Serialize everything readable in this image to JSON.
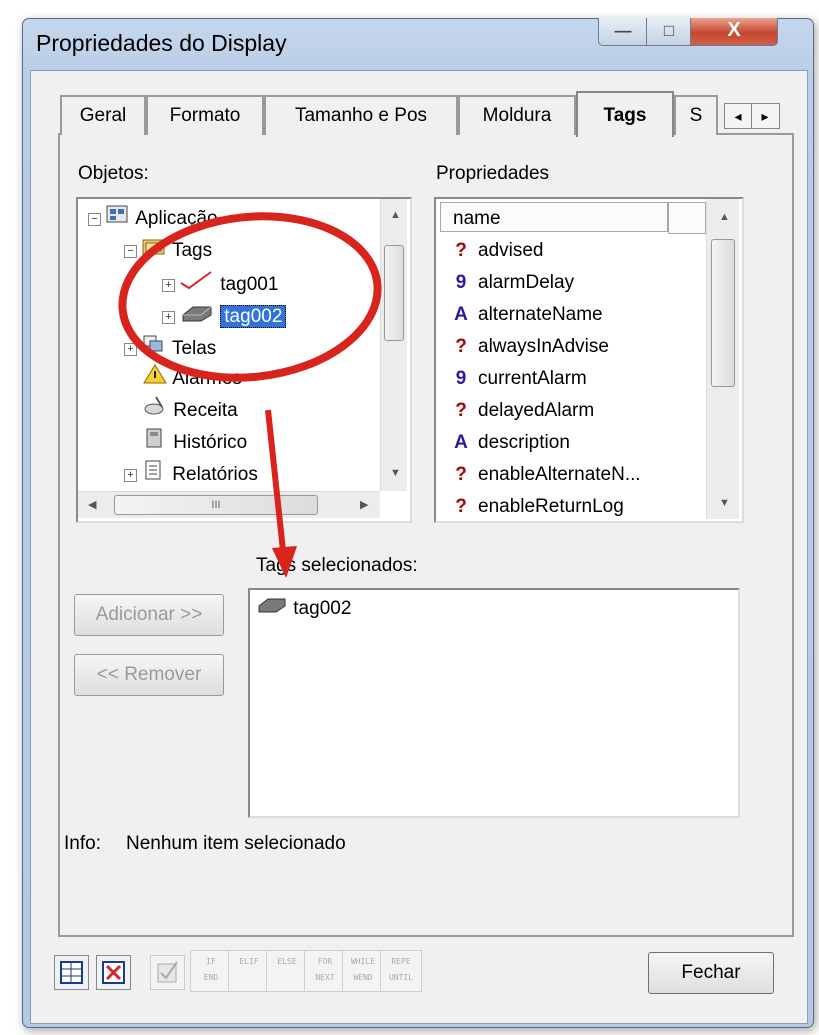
{
  "window": {
    "title": "Propriedades do Display",
    "minimize_glyph": "—",
    "maximize_glyph": "□",
    "close_glyph": "X"
  },
  "tabs": [
    {
      "label": "Geral"
    },
    {
      "label": "Formato"
    },
    {
      "label": "Tamanho e Pos"
    },
    {
      "label": "Moldura"
    },
    {
      "label": "Tags"
    },
    {
      "label": "S"
    }
  ],
  "tab_scroll": {
    "left": "◂",
    "right": "▸"
  },
  "objetos": {
    "label": "Objetos:",
    "tree": [
      {
        "label": "Aplicação",
        "expander": "−",
        "icon": "application-icon"
      },
      {
        "label": "Tags",
        "expander": "−",
        "icon": "folder-icon"
      },
      {
        "label": "tag001",
        "expander": "+",
        "icon": "trend-icon"
      },
      {
        "label": "tag002",
        "expander": "+",
        "icon": "tag-icon",
        "selected": true
      },
      {
        "label": "Telas",
        "expander": "+",
        "icon": "screens-icon"
      },
      {
        "label": "Alarmes",
        "icon": "alarm-icon"
      },
      {
        "label": "Receita",
        "icon": "recipe-icon"
      },
      {
        "label": "Histórico",
        "icon": "history-icon"
      },
      {
        "label": "Relatórios",
        "expander": "+",
        "icon": "report-icon"
      }
    ],
    "hscroll_grip": "III"
  },
  "propriedades": {
    "label": "Propriedades",
    "column_header": "name",
    "items": [
      {
        "name": "advised",
        "type_glyph": "?",
        "icon": "boolean-icon",
        "color": "#b00000"
      },
      {
        "name": "alarmDelay",
        "type_glyph": "9",
        "icon": "number-icon",
        "color": "#2a1aa0"
      },
      {
        "name": "alternateName",
        "type_glyph": "A",
        "icon": "string-icon",
        "color": "#2a1aa0"
      },
      {
        "name": "alwaysInAdvise",
        "type_glyph": "?",
        "icon": "boolean-icon",
        "color": "#b00000"
      },
      {
        "name": "currentAlarm",
        "type_glyph": "9",
        "icon": "number-icon",
        "color": "#2a1aa0"
      },
      {
        "name": "delayedAlarm",
        "type_glyph": "?",
        "icon": "boolean-icon",
        "color": "#b00000"
      },
      {
        "name": "description",
        "type_glyph": "A",
        "icon": "string-icon",
        "color": "#2a1aa0"
      },
      {
        "name": "enableAlternateN...",
        "type_glyph": "?",
        "icon": "boolean-icon",
        "color": "#b00000"
      },
      {
        "name": "enableReturnLog",
        "type_glyph": "?",
        "icon": "boolean-icon",
        "color": "#b00000"
      }
    ]
  },
  "buttons": {
    "adicionar": "Adicionar >>",
    "remover": "<< Remover",
    "fechar": "Fechar"
  },
  "selected_tags": {
    "label": "Tags selecionados:",
    "items": [
      "tag002"
    ]
  },
  "info": {
    "label": "Info:",
    "text": "Nenhum item selecionado"
  },
  "toolbar": {
    "script_buttons": [
      {
        "top": "IF",
        "bottom": "END"
      },
      {
        "top": "ELIF",
        "bottom": ""
      },
      {
        "top": "ELSE",
        "bottom": ""
      },
      {
        "top": "FOR",
        "bottom": "NEXT"
      },
      {
        "top": "WHILE",
        "bottom": "WEND"
      },
      {
        "top": "REPE",
        "bottom": "UNTIL"
      }
    ]
  },
  "annotation": {
    "color": "#d9231d"
  }
}
